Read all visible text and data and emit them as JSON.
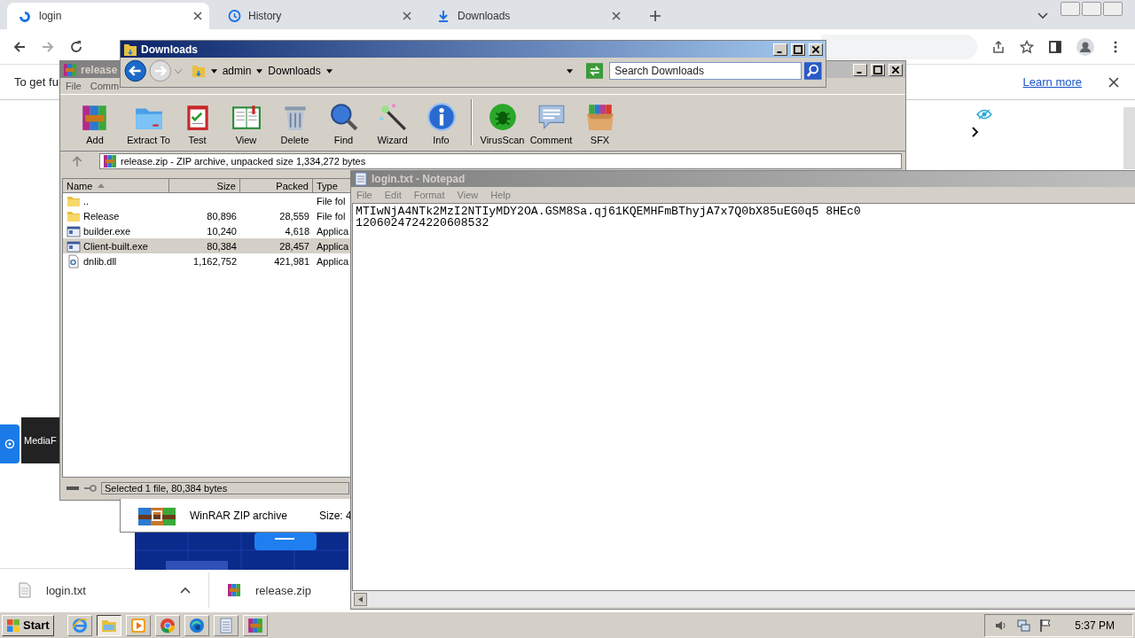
{
  "browser": {
    "tabs": [
      {
        "title": "login",
        "selected": true
      },
      {
        "title": "History",
        "selected": false
      },
      {
        "title": "Downloads",
        "selected": false
      }
    ],
    "infobar": {
      "message": "To get fu",
      "link": "Learn more"
    },
    "widget_label": "MediaF",
    "downloads": [
      {
        "name": "login.txt",
        "kind": "text"
      },
      {
        "name": "release.zip",
        "kind": "archive"
      }
    ]
  },
  "winrar": {
    "title": "release",
    "menu": [
      "File",
      "Comm"
    ],
    "tools": [
      "Add",
      "Extract To",
      "Test",
      "View",
      "Delete",
      "Find",
      "Wizard",
      "Info",
      "VirusScan",
      "Comment",
      "SFX"
    ],
    "path": "release.zip - ZIP archive, unpacked size 1,334,272 bytes",
    "columns": [
      "Name",
      "Size",
      "Packed",
      "Type"
    ],
    "rows": [
      {
        "kind": "folder",
        "name": "..",
        "type": "File fol",
        "selected": false
      },
      {
        "kind": "folder",
        "name": "Release",
        "size": "80,896",
        "packed": "28,559",
        "type": "File fol",
        "selected": false
      },
      {
        "kind": "exe",
        "name": "builder.exe",
        "size": "10,240",
        "packed": "4,618",
        "type": "Applica",
        "selected": false
      },
      {
        "kind": "exe",
        "name": "Client-built.exe",
        "size": "80,384",
        "packed": "28,457",
        "type": "Applica",
        "selected": true
      },
      {
        "kind": "dll",
        "name": "dnlib.dll",
        "size": "1,162,752",
        "packed": "421,981",
        "type": "Applica",
        "selected": false
      }
    ],
    "status": "Selected 1 file, 80,384 bytes"
  },
  "explorer": {
    "title": "Downloads",
    "breadcrumb": [
      "admin",
      "Downloads"
    ],
    "search_placeholder": "Search Downloads",
    "details": {
      "type": "WinRAR ZIP archive",
      "size": "Size: 4"
    }
  },
  "notepad": {
    "title": "login.txt - Notepad",
    "menu": [
      "File",
      "Edit",
      "Format",
      "View",
      "Help"
    ],
    "lines": [
      {
        "segments": [
          "MTIwNjA4NTk2MzI2NTIyMDY2OA.GSM8Sa.qj61KQEMHFmBThyjA7x7Q0bX85uEG0q5",
          "8HEc0"
        ]
      },
      {
        "segments": [
          "1206024724220608532"
        ]
      }
    ]
  },
  "taskbar": {
    "start": "Start",
    "apps": [
      {
        "kind": "ie",
        "selected": false
      },
      {
        "kind": "explorer",
        "selected": true
      },
      {
        "kind": "media",
        "selected": false
      },
      {
        "kind": "chrome",
        "selected": false
      },
      {
        "kind": "edge",
        "selected": false
      },
      {
        "kind": "notepad",
        "selected": false
      },
      {
        "kind": "winrar",
        "selected": false
      }
    ],
    "clock": "5:37 PM"
  }
}
